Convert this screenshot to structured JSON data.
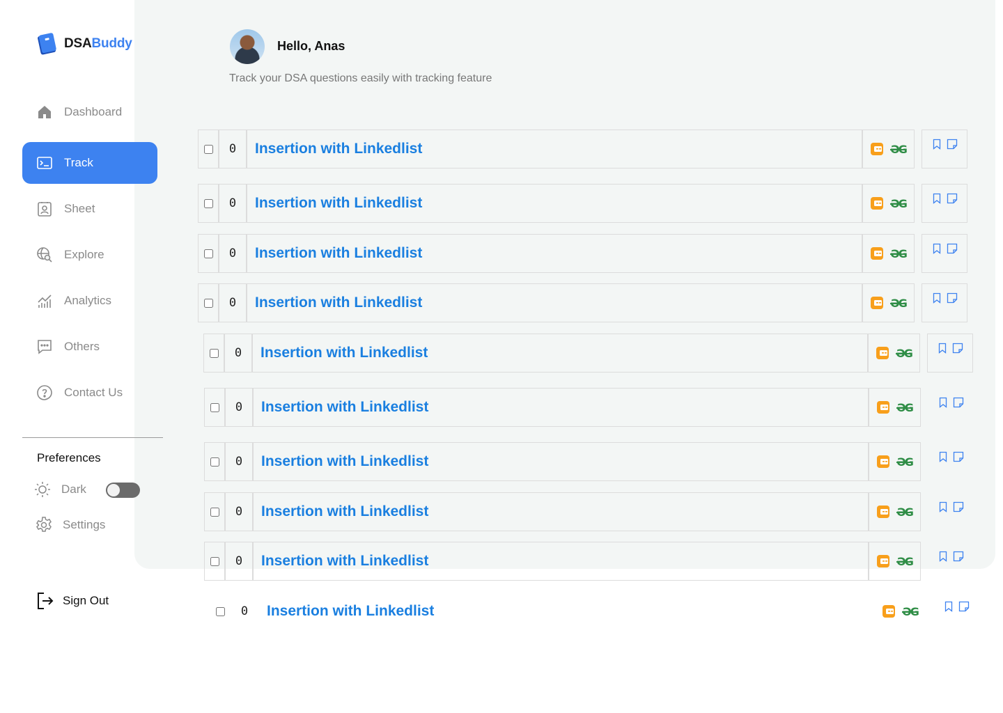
{
  "brand": {
    "part1": "DSA",
    "part2": "Buddy"
  },
  "sidebar": {
    "items": [
      {
        "label": "Dashboard"
      },
      {
        "label": "Track"
      },
      {
        "label": "Sheet"
      },
      {
        "label": "Explore"
      },
      {
        "label": "Analytics"
      },
      {
        "label": "Others"
      },
      {
        "label": "Contact Us"
      }
    ],
    "active": "Track",
    "preferences_title": "Preferences",
    "dark_label": "Dark",
    "dark_mode_on": false,
    "settings_label": "Settings",
    "signout_label": "Sign Out"
  },
  "header": {
    "greeting": "Hello, Anas",
    "subtitle": "Track your DSA questions easily with tracking feature"
  },
  "questions": [
    {
      "count": "0",
      "title": "Insertion with Linkedlist",
      "checked": false
    },
    {
      "count": "0",
      "title": "Insertion with Linkedlist",
      "checked": false
    },
    {
      "count": "0",
      "title": "Insertion with Linkedlist",
      "checked": false
    },
    {
      "count": "0",
      "title": "Insertion with Linkedlist",
      "checked": false
    },
    {
      "count": "0",
      "title": "Insertion with Linkedlist",
      "checked": false
    },
    {
      "count": "0",
      "title": "Insertion with Linkedlist",
      "checked": false
    },
    {
      "count": "0",
      "title": "Insertion with Linkedlist",
      "checked": false
    },
    {
      "count": "0",
      "title": "Insertion with Linkedlist",
      "checked": false
    },
    {
      "count": "0",
      "title": "Insertion with Linkedlist",
      "checked": false
    },
    {
      "count": "0",
      "title": "Insertion with Linkedlist",
      "checked": false
    }
  ],
  "colors": {
    "accent": "#3d82f0",
    "link": "#1a7fe0",
    "leetcode": "#f89f1b",
    "gfg": "#2f8d46"
  },
  "icons": {
    "platform_1": "leetcode-icon",
    "platform_2": "geeksforgeeks-icon",
    "action_1": "bookmark-icon",
    "action_2": "note-icon"
  }
}
